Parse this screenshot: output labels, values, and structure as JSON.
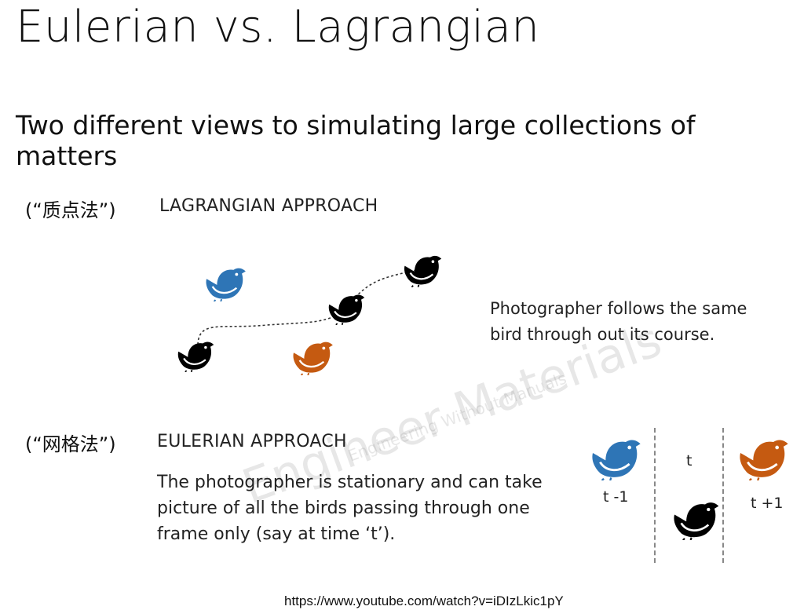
{
  "title": "Eulerian vs. Lagrangian",
  "subtitle": "Two different views to simulating large collections of matters",
  "lagrangian": {
    "cn_label": "(“质点法”)",
    "heading": "LAGRANGIAN APPROACH",
    "description_line1": "Photographer follows the same",
    "description_line2": "bird through out its course."
  },
  "eulerian": {
    "cn_label": "(“网格法”)",
    "heading": "EULERIAN APPROACH",
    "description_line1": "The photographer is stationary and can take",
    "description_line2": "picture of all the birds passing through one",
    "description_line3": "frame only (say at time  ‘t’).",
    "label_t_minus": "t -1",
    "label_t": "t",
    "label_t_plus": "t +1"
  },
  "watermark": {
    "line1": "Engineer Materials",
    "line2": "Engineering Without Manuals"
  },
  "source_url": "https://www.youtube.com/watch?v=iDIzLkic1pY",
  "colors": {
    "blue": "#2e75b6",
    "orange": "#c55a11",
    "black": "#000000"
  },
  "icons": [
    "bird-icon"
  ]
}
